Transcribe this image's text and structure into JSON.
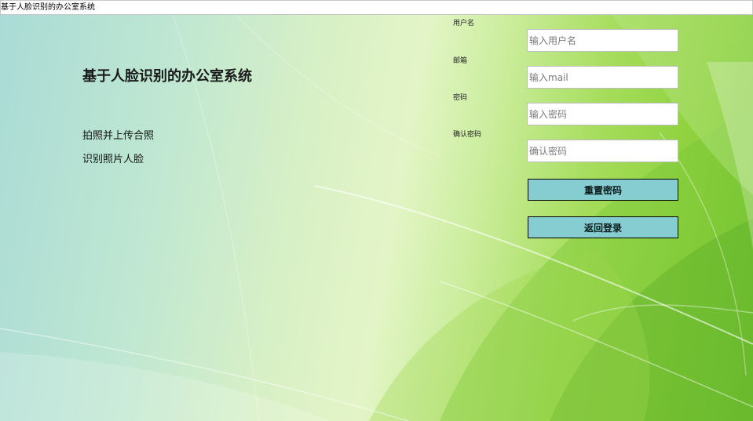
{
  "window": {
    "title": "基于人脸识别的办公室系统"
  },
  "main": {
    "title": "基于人脸识别的办公室系统",
    "links": [
      "拍照并上传合照",
      "识别照片人脸"
    ]
  },
  "form": {
    "fields": [
      {
        "label": "用户名",
        "placeholder": "输入用户名",
        "value": ""
      },
      {
        "label": "邮箱",
        "placeholder": "输入mail",
        "value": ""
      },
      {
        "label": "密码",
        "placeholder": "输入密码",
        "value": ""
      },
      {
        "label": "确认密码",
        "placeholder": "确认密码",
        "value": ""
      }
    ],
    "buttons": {
      "reset": "重置密码",
      "back": "返回登录"
    }
  },
  "colors": {
    "button_bg": "#86cdd1",
    "button_border": "#000000",
    "bg_left": "#aadbd6",
    "bg_right": "#6cbf2a"
  }
}
